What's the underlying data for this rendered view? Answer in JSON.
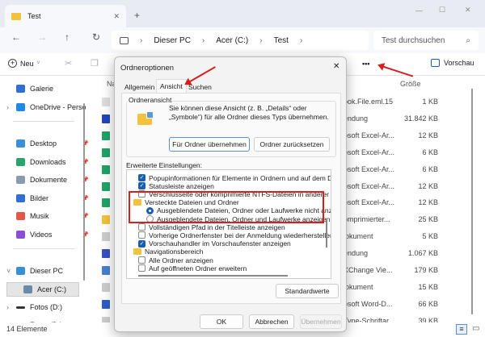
{
  "window": {
    "tab_title": "Test",
    "new_tab": "+",
    "close_tab": "✕",
    "minimize": "—",
    "maximize": "☐",
    "close": "✕"
  },
  "address": {
    "crumbs": [
      "Dieser PC",
      "Acer (C:)",
      "Test"
    ],
    "search_placeholder": "Test durchsuchen"
  },
  "toolbar": {
    "new_label": "Neu",
    "more": "•••",
    "preview_label": "Vorschau"
  },
  "sidebar": {
    "items": [
      {
        "label": "Galerie",
        "color": "#2f6fd6"
      },
      {
        "label": "OneDrive - Perso",
        "color": "#1e88e5"
      },
      {
        "label": "Desktop",
        "color": "#3a8fd8",
        "pinned": true
      },
      {
        "label": "Downloads",
        "color": "#2aa56a",
        "pinned": true
      },
      {
        "label": "Dokumente",
        "color": "#8a9bb0",
        "pinned": true
      },
      {
        "label": "Bilder",
        "color": "#2f6fd6",
        "pinned": true
      },
      {
        "label": "Musik",
        "color": "#e2584b",
        "pinned": true
      },
      {
        "label": "Videos",
        "color": "#8a4fd6",
        "pinned": true
      },
      {
        "label": "Dieser PC",
        "color": "#3a8fd8"
      },
      {
        "label": "Acer (C:)",
        "color": "#6a8aa8"
      },
      {
        "label": "Fotos (D:)",
        "color": "#333"
      },
      {
        "label": "Fotos (D:)",
        "color": "#333"
      }
    ]
  },
  "list": {
    "col_name": "Na",
    "col_size": "Größe",
    "rows": [
      {
        "type": "ook.File.eml.15",
        "size": "1 KB",
        "color": "#ddd"
      },
      {
        "type": "endung",
        "size": "31.842 KB",
        "color": "#2546b8"
      },
      {
        "type": "osoft Excel-Ar...",
        "size": "12 KB",
        "color": "#21a366"
      },
      {
        "type": "osoft Excel-Ar...",
        "size": "6 KB",
        "color": "#21a366"
      },
      {
        "type": "osoft Excel-Ar...",
        "size": "6 KB",
        "color": "#21a366"
      },
      {
        "type": "osoft Excel-Ar...",
        "size": "12 KB",
        "color": "#21a366"
      },
      {
        "type": "osoft Excel-Ar...",
        "size": "12 KB",
        "color": "#21a366"
      },
      {
        "type": "omprimierter...",
        "size": "25 KB",
        "color": "#f3c23c"
      },
      {
        "type": "lokument",
        "size": "5 KB",
        "color": "#ccc"
      },
      {
        "type": "endung",
        "size": "1.067 KB",
        "color": "#3a4fc0"
      },
      {
        "type": "XChange Vie...",
        "size": "179 KB",
        "color": "#4a7fd0"
      },
      {
        "type": "lokument",
        "size": "15 KB",
        "color": "#ccc"
      },
      {
        "type": "osoft Word-D...",
        "size": "66 KB",
        "color": "#2b5fc0"
      },
      {
        "type": "Type-Schriftar",
        "size": "39 KB",
        "color": "#ccc"
      }
    ]
  },
  "status": {
    "count": "14 Elemente"
  },
  "dialog": {
    "title": "Ordneroptionen",
    "close": "✕",
    "tabs": [
      "Allgemein",
      "Ansicht",
      "Suchen"
    ],
    "active_tab": "Ansicht",
    "group_title": "Ordneransicht",
    "group_text": "Sie können diese Ansicht (z. B. „Details“ oder „Symbole“) für alle Ordner dieses Typs übernehmen.",
    "apply_button": "Für Ordner übernehmen",
    "reset_button": "Ordner zurücksetzen",
    "advanced_label": "Erweiterte Einstellungen:",
    "options": [
      {
        "kind": "check",
        "checked": true,
        "label": "Popupinformationen für Elemente in Ordnern und auf dem Deskto"
      },
      {
        "kind": "check",
        "checked": true,
        "label": "Statusleiste anzeigen"
      },
      {
        "kind": "check",
        "checked": false,
        "label": "Verschlüsselte oder komprimierte NTFS-Dateien in anderer Farb"
      },
      {
        "kind": "folder",
        "label": "Versteckte Dateien und Ordner"
      },
      {
        "kind": "radio",
        "checked": true,
        "label": "Ausgeblendete Dateien, Ordner oder Laufwerke nicht anzeige"
      },
      {
        "kind": "radio",
        "checked": false,
        "label": "Ausgeblendete Dateien, Ordner und Laufwerke anzeigen"
      },
      {
        "kind": "check",
        "checked": false,
        "label": "Vollständigen Pfad in der Titelleiste anzeigen"
      },
      {
        "kind": "check",
        "checked": false,
        "label": "Vorherige Ordnerfenster bei der Anmeldung wiederherstellen"
      },
      {
        "kind": "check",
        "checked": true,
        "label": "Vorschauhandler im Vorschaufenster anzeigen"
      },
      {
        "kind": "folder",
        "label": "Navigationsbereich"
      },
      {
        "kind": "check",
        "checked": false,
        "label": "Alle Ordner anzeigen"
      },
      {
        "kind": "check",
        "checked": false,
        "label": "Auf geöffneten Ordner erweitern"
      }
    ],
    "defaults_button": "Standardwerte",
    "ok_button": "OK",
    "cancel_button": "Abbrechen",
    "apply_disabled_button": "Übernehmen"
  },
  "annotation_color": "#d62020"
}
